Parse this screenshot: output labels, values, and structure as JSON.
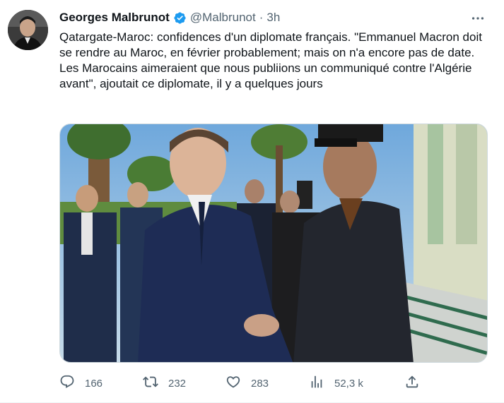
{
  "tweet": {
    "author_name": "Georges Malbrunot",
    "handle": "@Malbrunot",
    "separator": "·",
    "time": "3h",
    "text": "Qatargate-Maroc: confidences d'un diplomate français. \"Emmanuel Macron doit se rendre au Maroc, en février probablement; mais on n'a encore pas de date. Les Marocains aimeraient que nous publiions un communiqué contre l'Algérie avant\", ajoutait ce diplomate, il y a quelques jours"
  },
  "actions": {
    "replies": "166",
    "retweets": "232",
    "likes": "283",
    "views": "52,3 k"
  },
  "colors": {
    "verified": "#1d9bf0",
    "muted_text": "#536471",
    "primary_text": "#0f1419"
  },
  "icons": {
    "verified": "verified-badge-icon",
    "more": "more-dots-icon",
    "reply": "reply-icon",
    "retweet": "retweet-icon",
    "like": "heart-icon",
    "views": "views-icon",
    "share": "share-icon"
  }
}
